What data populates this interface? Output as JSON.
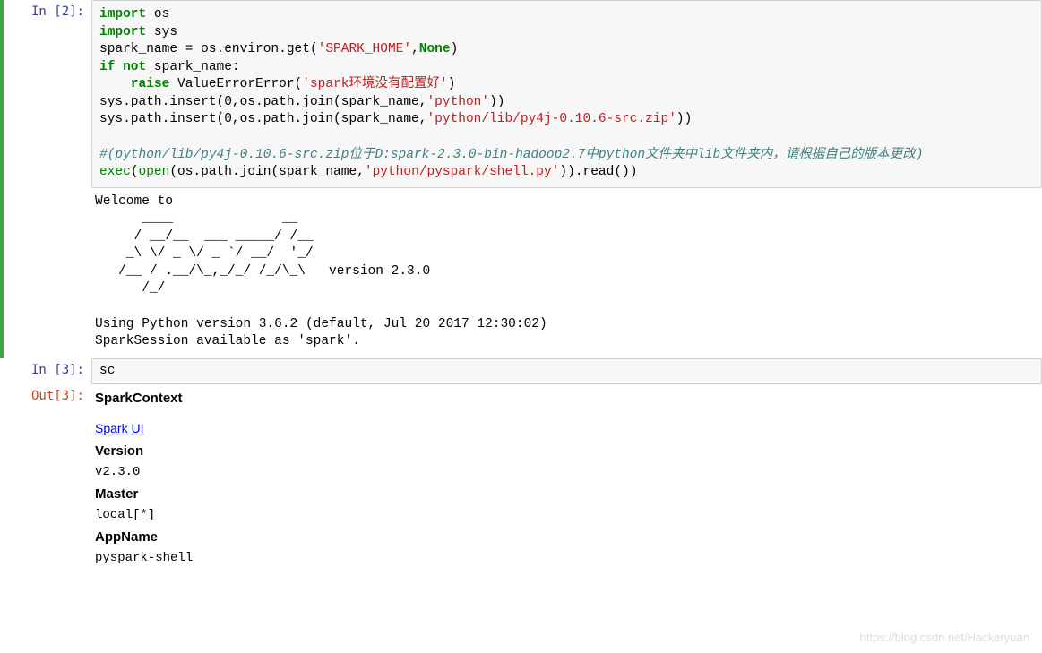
{
  "cells": {
    "c2": {
      "in_label": "In  [2]:",
      "code": {
        "l1a": "import",
        "l1b": " os",
        "l2a": "import",
        "l2b": " sys",
        "l3a": "spark_name = os.environ.get(",
        "l3b": "'SPARK_HOME'",
        "l3c": ",",
        "l3d": "None",
        "l3e": ")",
        "l4a": "if",
        "l4b": " ",
        "l4c": "not",
        "l4d": " spark_name:",
        "l5a": "    ",
        "l5b": "raise",
        "l5c": " ValueErrorError(",
        "l5d": "'spark环境没有配置好'",
        "l5e": ")",
        "l6a": "sys.path.insert(0,os.path.join(spark_name,",
        "l6b": "'python'",
        "l6c": "))",
        "l7a": "sys.path.insert(0,os.path.join(spark_name,",
        "l7b": "'python/lib/py4j-0.10.6-src.zip'",
        "l7c": "))",
        "l8": "",
        "l9": "#(python/lib/py4j-0.10.6-src.zip位于D:spark-2.3.0-bin-hadoop2.7中python文件夹中lib文件夹内，请根据自己的版本更改)",
        "l10a": "exec",
        "l10b": "(",
        "l10c": "open",
        "l10d": "(os.path.join(spark_name,",
        "l10e": "'python/pyspark/shell.py'",
        "l10f": ")).read())"
      },
      "output": "Welcome to\n      ____              __\n     / __/__  ___ _____/ /__\n    _\\ \\/ _ \\/ _ `/ __/  '_/\n   /__ / .__/\\_,_/_/ /_/\\_\\   version 2.3.0\n      /_/\n\nUsing Python version 3.6.2 (default, Jul 20 2017 12:30:02)\nSparkSession available as 'spark'."
    },
    "c3": {
      "in_label": "In  [3]:",
      "code": "sc",
      "out_label": "Out[3]:",
      "sc": {
        "title": "SparkContext",
        "link": "Spark UI",
        "version_h": "Version",
        "version_v": "v2.3.0",
        "master_h": "Master",
        "master_v": "local[*]",
        "appname_h": "AppName",
        "appname_v": "pyspark-shell"
      }
    }
  },
  "watermark": "https://blog.csdn.net/Hackeryuan"
}
